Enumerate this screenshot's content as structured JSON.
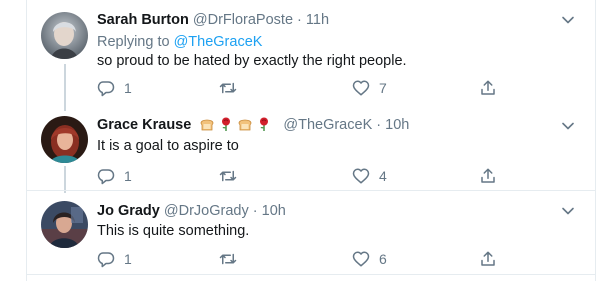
{
  "tweets": [
    {
      "name": "Sarah Burton",
      "handle": "@DrFloraPoste",
      "sep": "·",
      "time": "11h",
      "replying_prefix": "Replying to",
      "replying_to": "@TheGraceK",
      "text": "so proud to be hated by exactly the right people.",
      "reply_count": "1",
      "like_count": "7",
      "avatar_icon": "avatar-photo"
    },
    {
      "name": "Grace Krause",
      "handle": "@TheGraceK",
      "sep": "·",
      "time": "10h",
      "name_emojis": [
        "bread-emoji",
        "rose-emoji",
        "bread-emoji",
        "rose-emoji"
      ],
      "text": "It is a goal to aspire to",
      "reply_count": "1",
      "like_count": "4",
      "avatar_icon": "avatar-photo"
    },
    {
      "name": "Jo Grady",
      "handle": "@DrJoGrady",
      "sep": "·",
      "time": "10h",
      "text": "This is quite something.",
      "reply_count": "1",
      "like_count": "6",
      "avatar_icon": "avatar-photo"
    }
  ],
  "icons": {
    "reply": "reply-icon",
    "retweet": "retweet-icon",
    "like": "heart-icon",
    "share": "share-icon",
    "menu": "chevron-down-icon"
  },
  "colors": {
    "text": "#14171a",
    "secondary": "#657786",
    "accent": "#1da1f2",
    "thread_line": "#ccd6dd",
    "divider": "#e6ecf0"
  }
}
